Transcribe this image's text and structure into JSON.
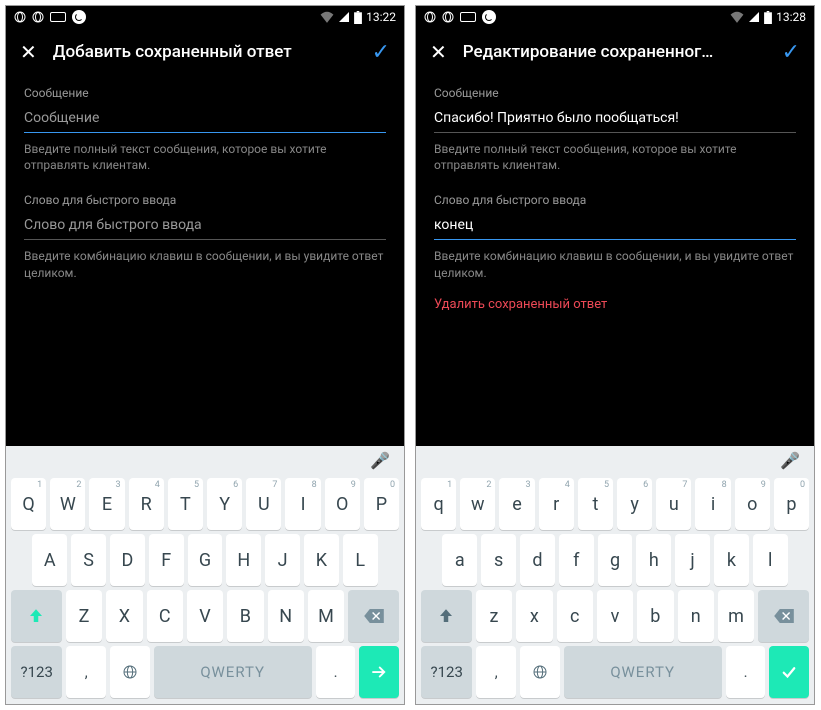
{
  "left": {
    "status": {
      "time": "13:22"
    },
    "header": {
      "title": "Добавить сохраненный ответ"
    },
    "msg": {
      "label": "Сообщение",
      "value": "",
      "placeholder": "Сообщение",
      "hint": "Введите полный текст сообщения, которое вы хотите отправлять клиентам."
    },
    "word": {
      "label": "Слово для быстрого ввода",
      "value": "",
      "placeholder": "Слово для быстрого ввода",
      "hint": "Введите комбинацию клавиш в сообщении, и вы увидите ответ целиком."
    },
    "kb": {
      "r1": [
        "Q",
        "W",
        "E",
        "R",
        "T",
        "Y",
        "U",
        "I",
        "O",
        "P"
      ],
      "nums": [
        "1",
        "2",
        "3",
        "4",
        "5",
        "6",
        "7",
        "8",
        "9",
        "0"
      ],
      "r2": [
        "A",
        "S",
        "D",
        "F",
        "G",
        "H",
        "J",
        "K",
        "L"
      ],
      "r3": [
        "Z",
        "X",
        "C",
        "V",
        "B",
        "N",
        "M"
      ],
      "sym": "?123",
      "space": "QWERTY",
      "enter": "→"
    }
  },
  "right": {
    "status": {
      "time": "13:28"
    },
    "header": {
      "title": "Редактирование сохраненног…"
    },
    "msg": {
      "label": "Сообщение",
      "value": "Спасибо! Приятно было пообщаться!",
      "hint": "Введите полный текст сообщения, которое вы хотите отправлять клиентам."
    },
    "word": {
      "label": "Слово для быстрого ввода",
      "value": "конец",
      "hint": "Введите комбинацию клавиш в сообщении, и вы увидите ответ целиком."
    },
    "delete": "Удалить сохраненный ответ",
    "kb": {
      "r1": [
        "q",
        "w",
        "e",
        "r",
        "t",
        "y",
        "u",
        "i",
        "o",
        "p"
      ],
      "nums": [
        "1",
        "2",
        "3",
        "4",
        "5",
        "6",
        "7",
        "8",
        "9",
        "0"
      ],
      "r2": [
        "a",
        "s",
        "d",
        "f",
        "g",
        "h",
        "j",
        "k",
        "l"
      ],
      "r3": [
        "z",
        "x",
        "c",
        "v",
        "b",
        "n",
        "m"
      ],
      "sym": "?123",
      "space": "QWERTY",
      "enter": "✓"
    }
  }
}
